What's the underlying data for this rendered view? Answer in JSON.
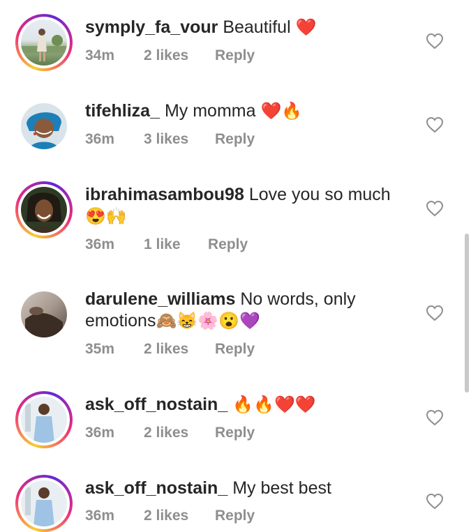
{
  "comments": [
    {
      "username": "symply_fa_vour",
      "text": "Beautiful",
      "emojis": "❤️",
      "time": "34m",
      "likes": "2 likes",
      "reply": "Reply",
      "avatar": "avatar-outdoor-photo",
      "ring": true
    },
    {
      "username": "tifehliza_",
      "text": "My momma",
      "emojis": "❤️🔥",
      "time": "36m",
      "likes": "3 likes",
      "reply": "Reply",
      "avatar": "avatar-woman-blue-headwrap",
      "ring": false
    },
    {
      "username": "ibrahimasambou98",
      "text": "Love you so much",
      "emojis": "😍🙌",
      "time": "36m",
      "likes": "1 like",
      "reply": "Reply",
      "avatar": "avatar-man-portrait",
      "ring": true
    },
    {
      "username": "darulene_williams",
      "text": "No words, only",
      "text2": "emotions",
      "emojis": "🙈😸🌸😮💜",
      "time": "35m",
      "likes": "2 likes",
      "reply": "Reply",
      "avatar": "avatar-dark-photo",
      "ring": false
    },
    {
      "username": "ask_off_nostain_",
      "text": "",
      "emojis": "🔥🔥❤️❤️",
      "time": "36m",
      "likes": "2 likes",
      "reply": "Reply",
      "avatar": "avatar-man-blue-shirt",
      "ring": true
    },
    {
      "username": "ask_off_nostain_",
      "text": "My best best",
      "emojis": "",
      "time": "36m",
      "likes": "2 likes",
      "reply": "Reply",
      "avatar": "avatar-man-blue-shirt",
      "ring": true
    }
  ],
  "icons": {
    "like": "heart-outline-icon"
  },
  "colors": {
    "text": "#262626",
    "meta": "#8e8e8e",
    "heart_stroke": "#8e8e8e"
  }
}
